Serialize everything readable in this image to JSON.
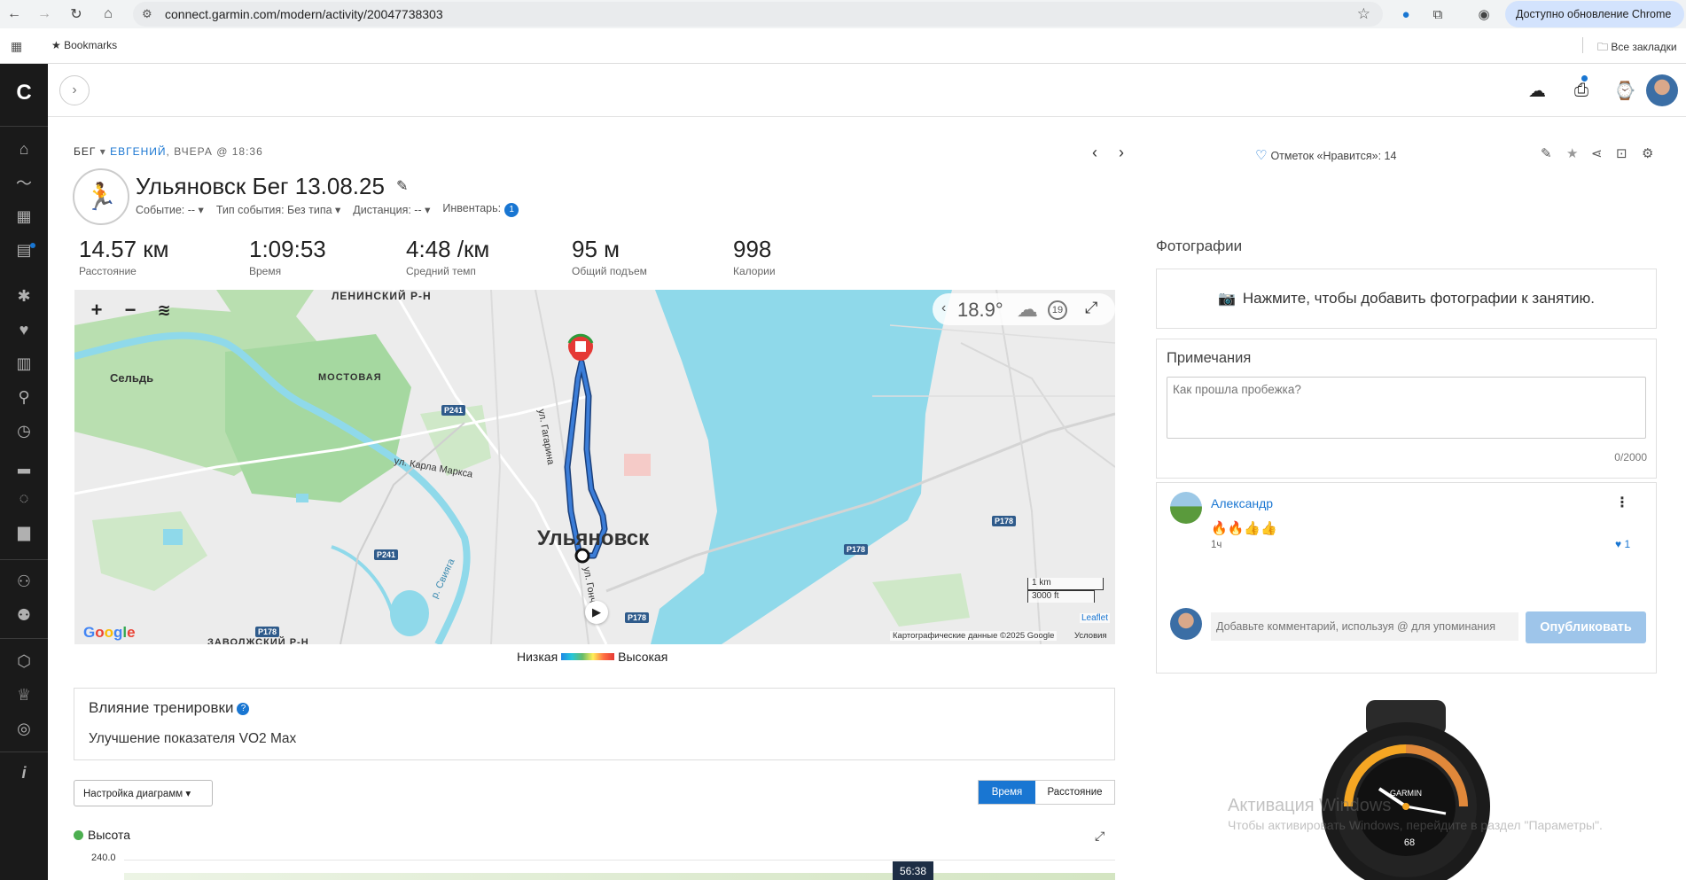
{
  "browser": {
    "url": "connect.garmin.com/modern/activity/20047738303",
    "update_label": "Доступно обновление Chrome",
    "bookmarks_label": "Bookmarks",
    "all_bookmarks_label": "Все закладки"
  },
  "activity": {
    "type": "БЕГ",
    "user": "ЕВГЕНИЙ",
    "when": "ВЧЕРА @ 18:36",
    "title": "Ульяновск Бег 13.08.25",
    "meta": {
      "event": "Событие: --",
      "event_type": "Тип события: Без типа",
      "distance": "Дистанция: --",
      "gear_label": "Инвентарь:",
      "gear_count": "1"
    },
    "likes": "Отметок «Нравится»: 14"
  },
  "stats": [
    {
      "value": "14.57 км",
      "label": "Расстояние"
    },
    {
      "value": "1:09:53",
      "label": "Время"
    },
    {
      "value": "4:48 /км",
      "label": "Средний темп"
    },
    {
      "value": "95 м",
      "label": "Общий подъем"
    },
    {
      "value": "998",
      "label": "Калории"
    }
  ],
  "map": {
    "city": "Ульяновск",
    "labels": {
      "district": "ЛЕНИНСКИЙ Р-Н",
      "selo": "Сельдь",
      "mostovaya": "МОСТОВАЯ",
      "karl_marx": "ул. Карла Маркса",
      "gagarina": "ул. Гагарина",
      "goncharova": "ул. Гонча",
      "sviyaga": "р. Свияга",
      "zav": "ЗАВОЛЖСКИЙ Р-Н"
    },
    "roads": [
      "P241",
      "P241",
      "P178",
      "P178",
      "P178",
      "P178"
    ],
    "weather_temp": "18.9°",
    "wind": "19",
    "scale_km": "1 km",
    "scale_ft": "3000 ft",
    "leaflet": "Leaflet",
    "attribution": "Картографические данные ©2025 Google",
    "terms": "Условия",
    "google": "Google",
    "legend_low": "Низкая",
    "legend_high": "Высокая"
  },
  "training_effect": {
    "title": "Влияние тренировки",
    "text": "Улучшение показателя VO2 Max"
  },
  "chart_controls": {
    "config_label": "Настройка диаграмм ▾",
    "time_label": "Время",
    "distance_label": "Расстояние",
    "altitude_label": "Высота",
    "y_value": "240.0",
    "tooltip": "56:38"
  },
  "right": {
    "photos_title": "Фотографии",
    "photos_cta": "Нажмите, чтобы добавить фотографии к занятию.",
    "notes_title": "Примечания",
    "notes_placeholder": "Как прошла пробежка?",
    "notes_count": "0/2000",
    "comment": {
      "author": "Александр",
      "text": "🔥🔥👍👍",
      "time": "1ч",
      "likes": "1"
    },
    "comment_placeholder": "Добавьте комментарий, используя @ для упоминания",
    "publish_label": "Опубликовать"
  },
  "watermark": {
    "line1": "Активация Windows",
    "line2": "Чтобы активировать Windows, перейдите в раздел \"Параметры\"."
  },
  "watch": {
    "brand": "GARMIN",
    "hr": "68"
  },
  "colors": {
    "accent": "#1976d2",
    "sidebar": "#1a1a1a",
    "water": "#8fd9ea",
    "route": "#3b7dd8"
  }
}
